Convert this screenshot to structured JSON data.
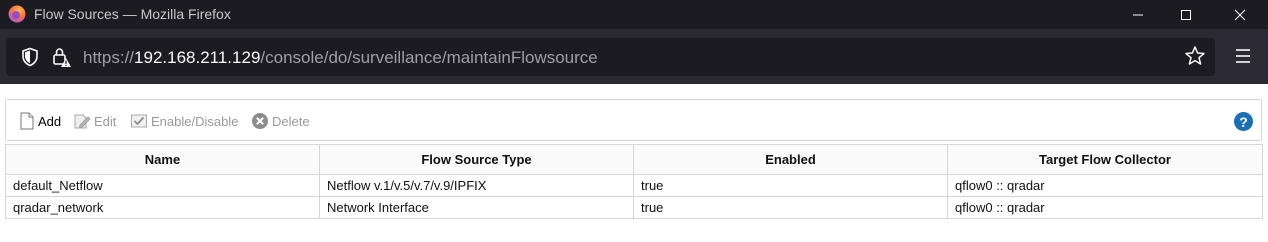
{
  "window": {
    "title": "Flow Sources — Mozilla Firefox"
  },
  "navbar": {
    "url_prefix": "https://",
    "url_host": "192.168.211.129",
    "url_path": "/console/do/surveillance/maintainFlowsource"
  },
  "toolbar": {
    "add_label": "Add",
    "edit_label": "Edit",
    "enable_label": "Enable/Disable",
    "delete_label": "Delete",
    "help_glyph": "?"
  },
  "table": {
    "headers": [
      "Name",
      "Flow Source Type",
      "Enabled",
      "Target Flow Collector"
    ],
    "rows": [
      [
        "default_Netflow",
        "Netflow v.1/v.5/v.7/v.9/IPFIX",
        "true",
        "qflow0 :: qradar"
      ],
      [
        "qradar_network",
        "Network Interface",
        "true",
        "qflow0 :: qradar"
      ]
    ]
  },
  "colors": {
    "titlebar": "#1c1b22",
    "navbar": "#2b2a33",
    "help_icon": "#1a6fb5"
  }
}
